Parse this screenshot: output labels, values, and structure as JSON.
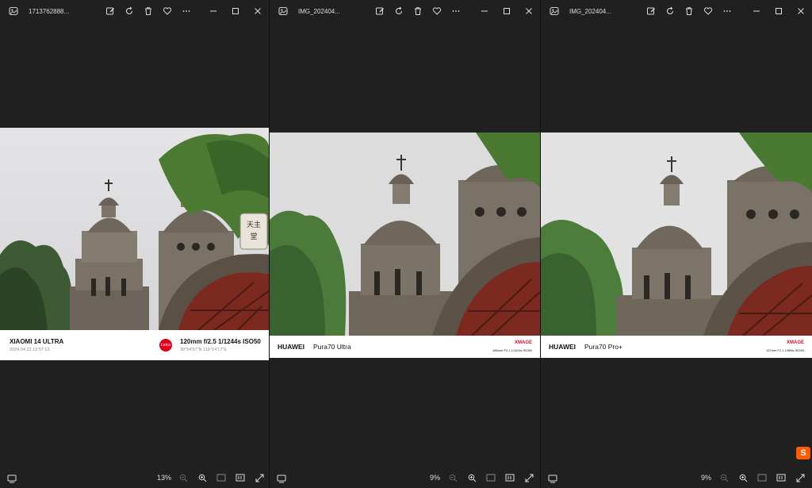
{
  "windows": [
    {
      "title": "1713762888...",
      "zoom": "13%",
      "frame": {
        "model": "XIAOMI 14 ULTRA",
        "datetime": "2024.04.22  12:57:13",
        "exif": "120mm  f/2.5  1/1244s  ISO50",
        "gps": "39°54'57\"N  116°24'17\"E"
      }
    },
    {
      "title": "IMG_202404...",
      "zoom": "9%",
      "frame": {
        "brand": "HUAWEI",
        "model": "Pura70 Ultra",
        "xmage": "XMAGE",
        "exif": "186mm  F2.1  1/1124s  ISO50"
      }
    },
    {
      "title": "IMG_202404...",
      "zoom": "9%",
      "frame": {
        "brand": "HUAWEI",
        "model": "Pura70 Pro+",
        "xmage": "XMAGE",
        "exif": "137mm  F2.1  1/985s  ISO50"
      }
    }
  ],
  "icons": {
    "app": "photos-app-icon",
    "edit": "edit-image-icon",
    "rotate": "rotate-icon",
    "delete": "trash-icon",
    "favorite": "heart-icon",
    "more": "more-icon",
    "minimize": "minimize-icon",
    "maximize": "maximize-icon",
    "close": "close-icon",
    "filmstrip": "filmstrip-icon",
    "zoom_out": "zoom-out-icon",
    "zoom_in": "zoom-in-icon",
    "fit": "fit-to-window-icon",
    "actual": "actual-size-icon",
    "fullscreen": "fullscreen-icon"
  },
  "watermark_glyph": "S",
  "colors": {
    "leica_red": "#e2001a",
    "xmage_red": "#c8102e",
    "watermark": "#ff5a00"
  }
}
